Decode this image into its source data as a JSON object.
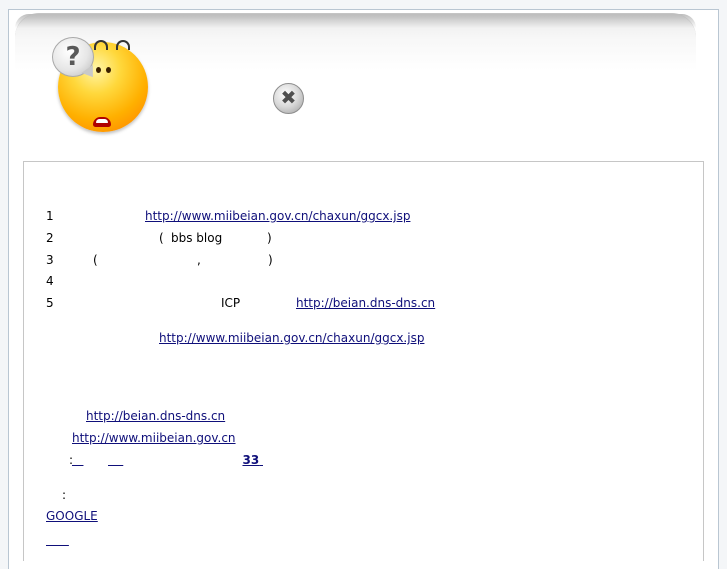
{
  "header": {
    "question_mark": "?",
    "close_symbol": "✖"
  },
  "list": [
    {
      "num": "1",
      "link": "http://www.miibeian.gov.cn/chaxun/ggcx.jsp"
    },
    {
      "num": "2",
      "open_paren": "(",
      "text": "bbs blog",
      "close_paren": ")"
    },
    {
      "num": "3",
      "open_paren": "(",
      "comma": ",",
      "close_paren": ")"
    },
    {
      "num": "4"
    },
    {
      "num": "5",
      "text": "ICP",
      "link": "http://beian.dns-dns.cn"
    }
  ],
  "link_center": "http://www.miibeian.gov.cn/chaxun/ggcx.jsp",
  "links_lower": {
    "dns": "http://beian.dns-dns.cn",
    "miibeian": "http://www.miibeian.gov.cn"
  },
  "colon_line": {
    "colon": ":",
    "field1": "   ",
    "field2": "    ",
    "field3": "33"
  },
  "colon_standalone": ":",
  "google": "GOOGLE",
  "last_link": "      "
}
